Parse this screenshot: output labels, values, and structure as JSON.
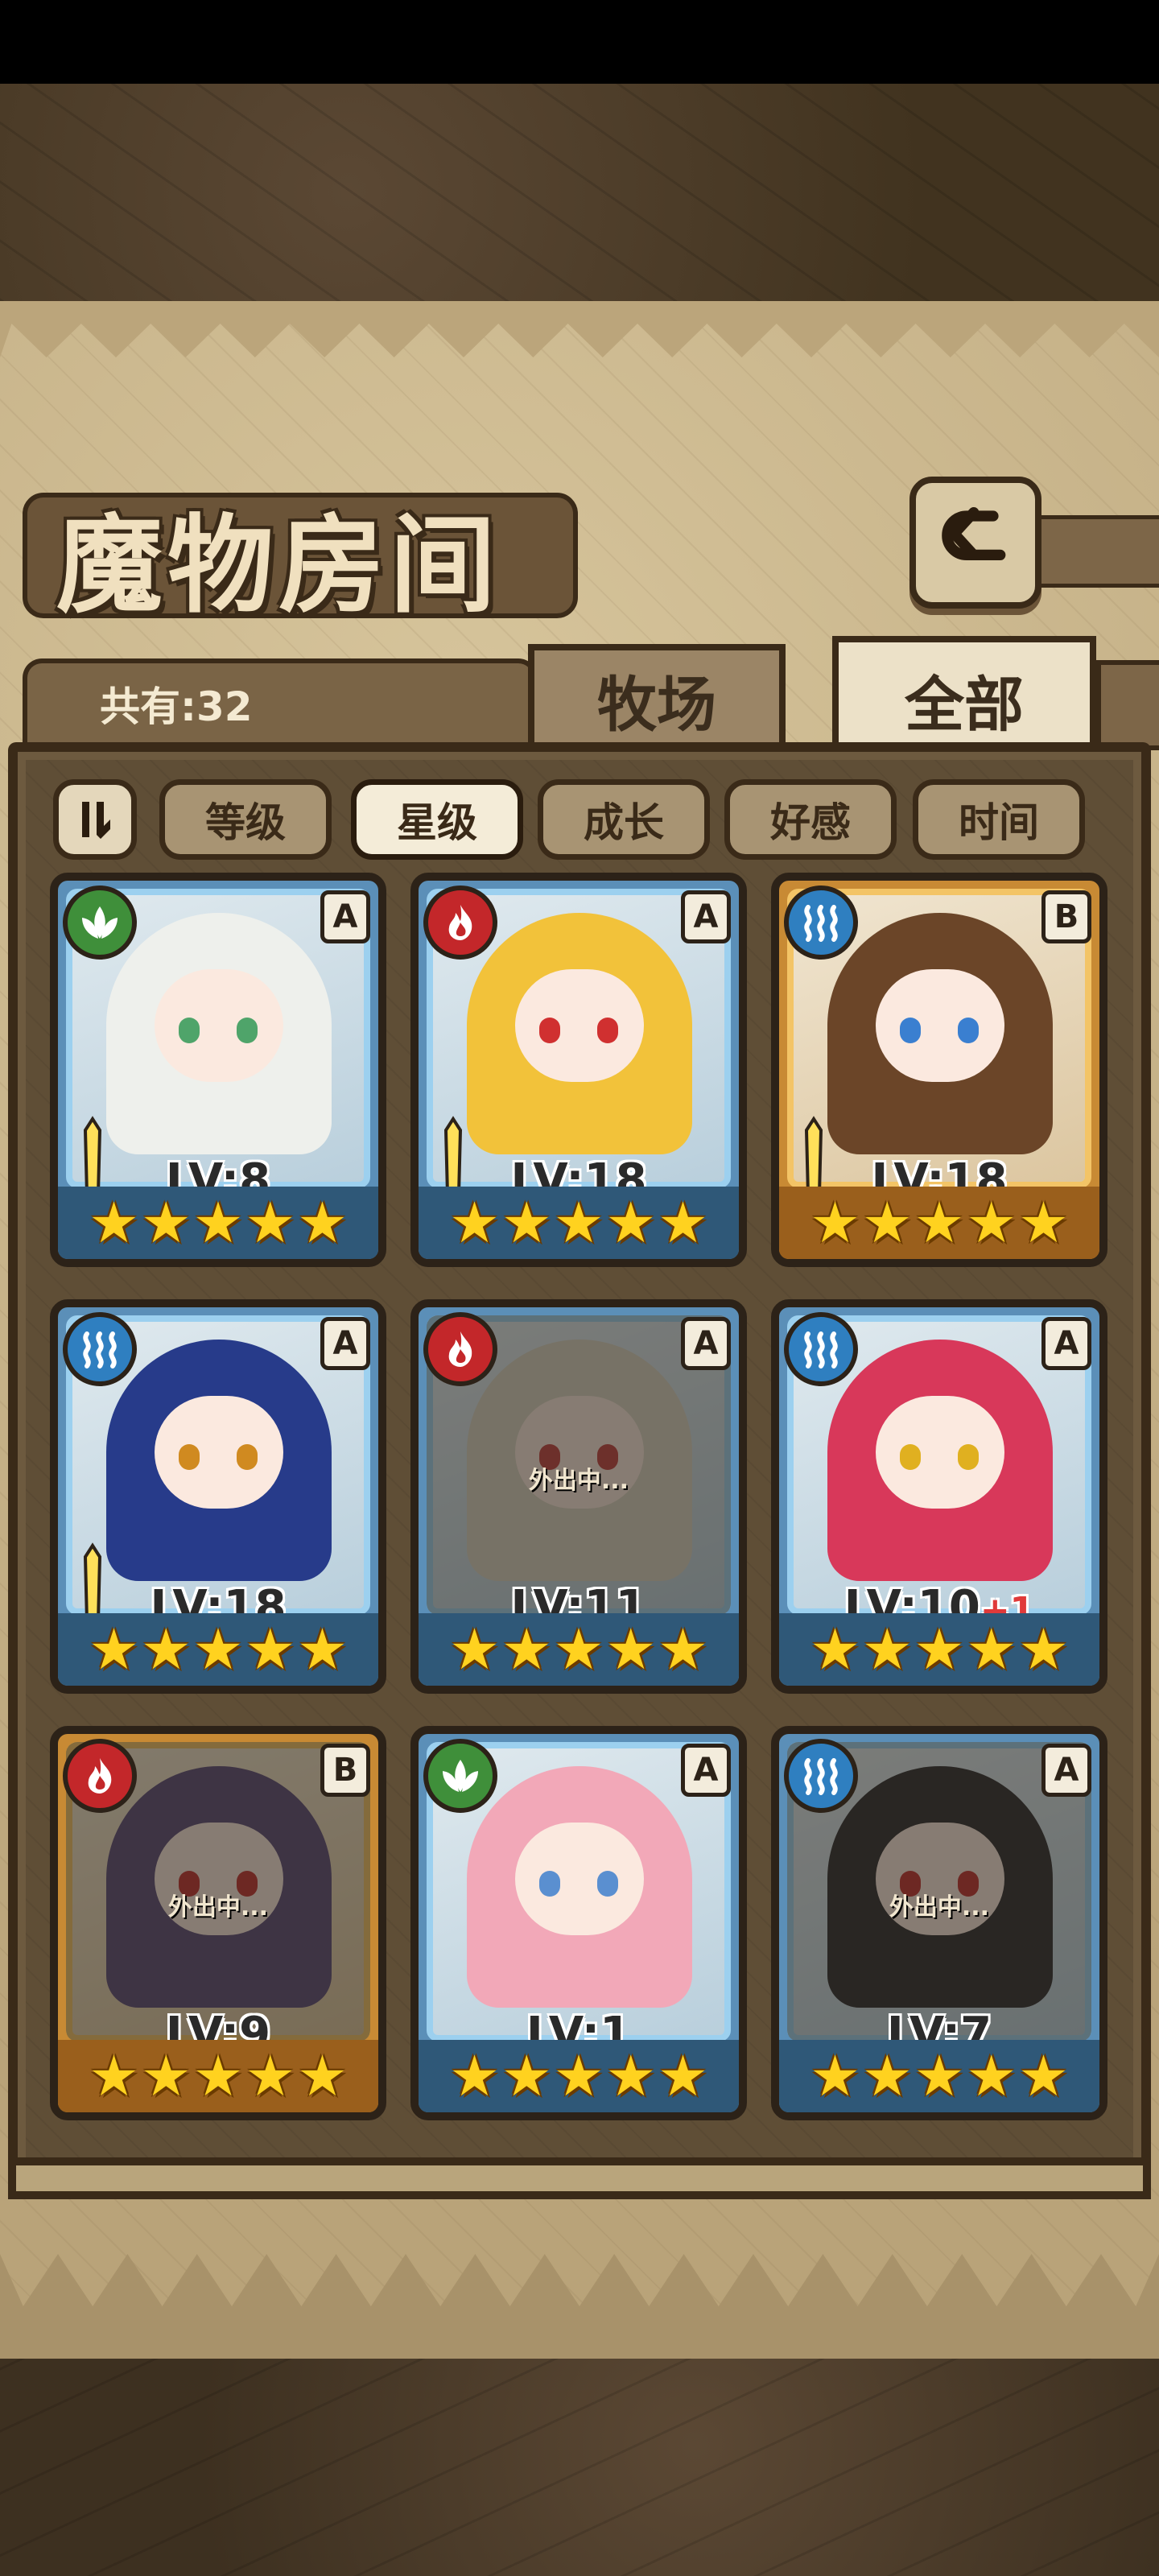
{
  "screen": {
    "title": "魔物房间",
    "count_label": "共有:32",
    "tabs": [
      {
        "label": "牧场",
        "selected": false
      },
      {
        "label": "全部",
        "selected": true
      }
    ],
    "sort_buttons": [
      {
        "label": "等级",
        "selected": false
      },
      {
        "label": "星级",
        "selected": true
      },
      {
        "label": "成长",
        "selected": false
      },
      {
        "label": "好感",
        "selected": false
      },
      {
        "label": "时间",
        "selected": false
      }
    ],
    "icons": {
      "back": "back-arrow-icon",
      "sort_order": "sort-order-icon"
    }
  },
  "monsters": [
    {
      "element": "leaf",
      "rank": "A",
      "level": "LV:8",
      "bonus": "",
      "stars": 5,
      "status": "",
      "sword": true,
      "hair": "#eef0ec",
      "eyes": "#4fa46a"
    },
    {
      "element": "fire",
      "rank": "A",
      "level": "LV:18",
      "bonus": "",
      "stars": 5,
      "status": "",
      "sword": true,
      "hair": "#f2c23a",
      "eyes": "#d03030"
    },
    {
      "element": "water",
      "rank": "B",
      "level": "LV:18",
      "bonus": "",
      "stars": 5,
      "status": "",
      "sword": true,
      "hair": "#6b4528",
      "eyes": "#3a7fd0"
    },
    {
      "element": "water",
      "rank": "A",
      "level": "LV:18",
      "bonus": "",
      "stars": 5,
      "status": "",
      "sword": true,
      "hair": "#273b8a",
      "eyes": "#d08a20"
    },
    {
      "element": "fire",
      "rank": "A",
      "level": "LV:11",
      "bonus": "",
      "stars": 5,
      "status": "外出中...",
      "sword": false,
      "hair": "#d8d3c4",
      "eyes": "#c04040"
    },
    {
      "element": "water",
      "rank": "A",
      "level": "LV:10",
      "bonus": "+1",
      "stars": 5,
      "status": "",
      "sword": false,
      "hair": "#d8385a",
      "eyes": "#e0b020"
    },
    {
      "element": "fire",
      "rank": "B",
      "level": "LV:9",
      "bonus": "",
      "stars": 5,
      "status": "外出中...",
      "sword": false,
      "hair": "#5a4a78",
      "eyes": "#c03030"
    },
    {
      "element": "leaf",
      "rank": "A",
      "level": "LV:1",
      "bonus": "",
      "stars": 5,
      "status": "",
      "sword": false,
      "hair": "#f2a8b8",
      "eyes": "#5a8fd0"
    },
    {
      "element": "water",
      "rank": "A",
      "level": "LV:7",
      "bonus": "",
      "stars": 5,
      "status": "外出中...",
      "sword": false,
      "hair": "#2a2a30",
      "eyes": "#c03030"
    }
  ]
}
